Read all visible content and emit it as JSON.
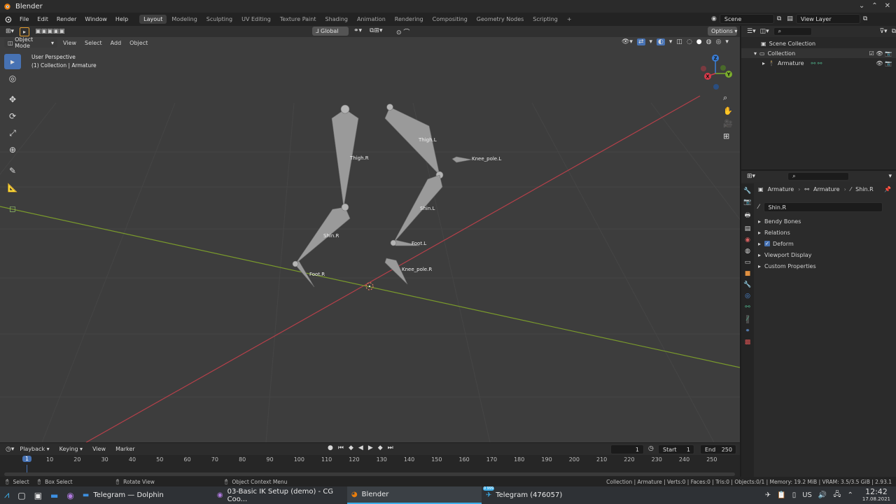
{
  "window": {
    "title": "Blender"
  },
  "menu": {
    "items": [
      "File",
      "Edit",
      "Render",
      "Window",
      "Help"
    ]
  },
  "workspaces": [
    "Layout",
    "Modeling",
    "Sculpting",
    "UV Editing",
    "Texture Paint",
    "Shading",
    "Animation",
    "Rendering",
    "Compositing",
    "Geometry Nodes",
    "Scripting"
  ],
  "active_workspace": "Layout",
  "scene": {
    "name": "Scene",
    "view_layer": "View Layer"
  },
  "viewport": {
    "transform_orientation": "Global",
    "options_label": "Options",
    "mode": "Object Mode",
    "header_menus": [
      "View",
      "Select",
      "Add",
      "Object"
    ],
    "overlay_text": {
      "line1": "User Perspective",
      "line2": "(1) Collection | Armature"
    },
    "bone_labels": [
      "Thigh.R",
      "Thigh.L",
      "Knee_pole.L",
      "Shin.L",
      "Shin.R",
      "Foot.L",
      "Knee_pole.R",
      "Foot.R"
    ],
    "gizmo_axes": [
      "Z",
      "Y",
      "X"
    ]
  },
  "outliner": {
    "root": "Scene Collection",
    "collection": "Collection",
    "object": "Armature"
  },
  "properties": {
    "breadcrumb": [
      "Armature",
      "Armature",
      "Shin.R"
    ],
    "bone_name": "Shin.R",
    "panels": [
      "Bendy Bones",
      "Relations",
      "Deform",
      "Viewport Display",
      "Custom Properties"
    ],
    "deform_checked": true
  },
  "timeline": {
    "menus": [
      "Playback",
      "Keying",
      "View",
      "Marker"
    ],
    "current_frame": "1",
    "start_label": "Start",
    "start": "1",
    "end_label": "End",
    "end": "250",
    "ruler": [
      "10",
      "20",
      "30",
      "40",
      "50",
      "60",
      "70",
      "80",
      "90",
      "100",
      "110",
      "120",
      "130",
      "140",
      "150",
      "160",
      "170",
      "180",
      "190",
      "200",
      "210",
      "220",
      "230",
      "240",
      "250"
    ],
    "playhead": "1"
  },
  "statusbar": {
    "select": "Select",
    "box_select": "Box Select",
    "rotate": "Rotate View",
    "context_menu": "Object Context Menu",
    "stats": "Collection | Armature | Verts:0 | Faces:0 | Tris:0 | Objects:0/1 | Memory: 19.2 MiB | VRAM: 3.5/3.5 GiB | 2.93.1"
  },
  "taskbar": {
    "tasks": [
      "Telegram — Dolphin",
      "03-Basic IK Setup (demo) - CG Coo...",
      "Blender",
      "Telegram (476057)"
    ],
    "badge": "9 999",
    "keyboard_layout": "US",
    "time": "12:42",
    "date": "17.08.2021"
  },
  "colors": {
    "accent": "#4772b3",
    "x_axis": "#c0424c",
    "y_axis": "#7ea12f",
    "viewport_bg": "#3d3d3d",
    "bone": "#9a9a9a"
  }
}
